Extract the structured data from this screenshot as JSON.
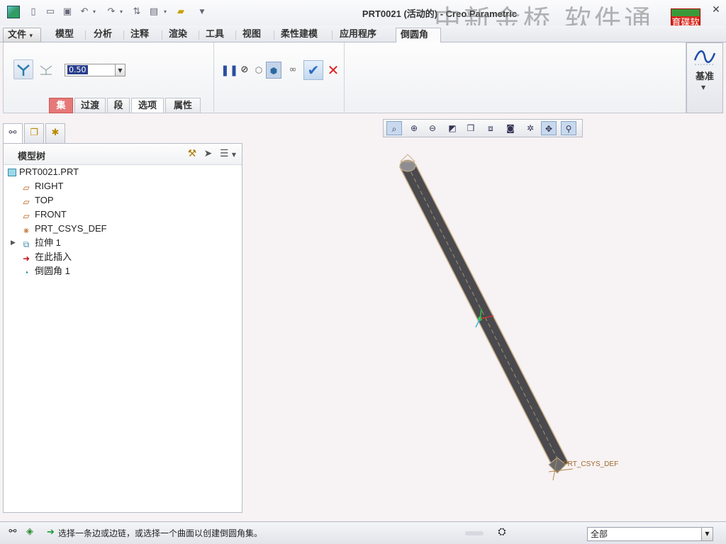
{
  "window": {
    "title": "PRT0021 (活动的) - Creo Parametric",
    "watermark": "中新金桥 软件通",
    "watermark_logo": "育碟软件"
  },
  "ribbon": {
    "tabs": [
      {
        "label": "文件",
        "name": "tab-file"
      },
      {
        "label": "模型",
        "name": "tab-model"
      },
      {
        "label": "分析",
        "name": "tab-analysis"
      },
      {
        "label": "注释",
        "name": "tab-annotate"
      },
      {
        "label": "渲染",
        "name": "tab-render"
      },
      {
        "label": "工具",
        "name": "tab-tools"
      },
      {
        "label": "视图",
        "name": "tab-view"
      },
      {
        "label": "柔性建模",
        "name": "tab-flexible-modeling"
      },
      {
        "label": "应用程序",
        "name": "tab-applications"
      },
      {
        "label": "倒圆角",
        "name": "tab-round"
      }
    ],
    "file_arrow": "▾",
    "radius_value": "0.50",
    "subtabs": [
      "集",
      "过渡",
      "段",
      "选项",
      "属性"
    ],
    "datum_label": "基准"
  },
  "model_tree": {
    "title": "模型树",
    "items": [
      {
        "label": "PRT0021.PRT"
      },
      {
        "label": "RIGHT"
      },
      {
        "label": "TOP"
      },
      {
        "label": "FRONT"
      },
      {
        "label": "PRT_CSYS_DEF"
      },
      {
        "label": "拉伸 1"
      },
      {
        "label": "在此插入"
      },
      {
        "label": "倒圆角 1"
      }
    ]
  },
  "viewport": {
    "csys_label": "PRT_CSYS_DEF"
  },
  "status": {
    "message": "选择一条边或边链，或选择一个曲面以创建倒圆角集。",
    "filter_value": "全部"
  }
}
